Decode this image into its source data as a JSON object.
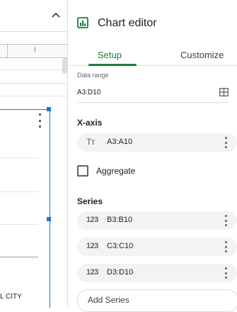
{
  "sheet": {
    "column_letter": "I",
    "cell_text": "L CITY"
  },
  "editor": {
    "title": "Chart editor",
    "tabs": [
      {
        "label": "Setup",
        "active": true
      },
      {
        "label": "Customize",
        "active": false
      }
    ],
    "data_range": {
      "label": "Data range",
      "value": "A3:D10"
    },
    "x_axis": {
      "title": "X-axis",
      "icon": "text-type-icon",
      "icon_glyph": "Tт",
      "value": "A3:A10"
    },
    "aggregate": {
      "label": "Aggregate",
      "checked": false
    },
    "series": {
      "title": "Series",
      "icon": "number-type-icon",
      "icon_glyph": "123",
      "items": [
        {
          "value": "B3:B10"
        },
        {
          "value": "C3:C10"
        },
        {
          "value": "D3:D10"
        }
      ]
    },
    "add_series_label": "Add Series"
  },
  "colors": {
    "accent_green": "#188038",
    "selection_blue": "#1a73e8",
    "pill_bg": "#f1f3f4"
  }
}
